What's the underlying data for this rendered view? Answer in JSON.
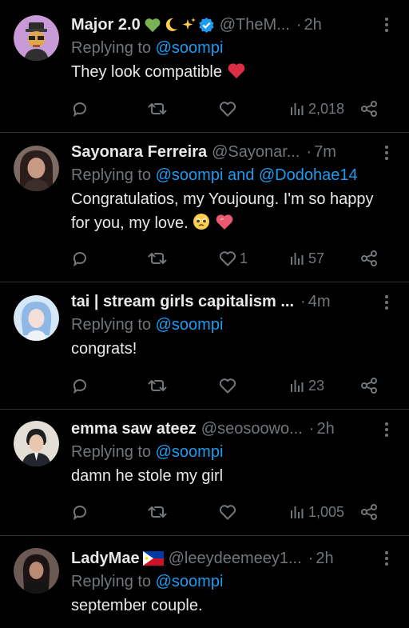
{
  "tweets": [
    {
      "name": "Major 2.0",
      "verified": true,
      "handle": "@TheM...",
      "time": "2h",
      "reply_prefix": "Replying to ",
      "reply_to": "@soompi",
      "text": "They look compatible",
      "likes": "",
      "views": "2,018"
    },
    {
      "name": "Sayonara Ferreira",
      "handle": "@Sayonar...",
      "time": "7m",
      "reply_prefix": "Replying to ",
      "reply_to": "@soompi and @Dodohae14",
      "text": "Congratulatios, my Youjoung. I'm so happy for you, my love.",
      "likes": "1",
      "views": "57"
    },
    {
      "name": "tai | stream girls capitalism ...",
      "time": "4m",
      "reply_prefix": "Replying to ",
      "reply_to": "@soompi",
      "text": "congrats!",
      "likes": "",
      "views": "23"
    },
    {
      "name": "emma saw ateez",
      "handle": "@seosoowo...",
      "time": "2h",
      "reply_prefix": "Replying to ",
      "reply_to": "@soompi",
      "text": "damn he stole my girl",
      "likes": "",
      "views": "1,005"
    },
    {
      "name": "LadyMae",
      "handle": "@leeydeemeey1...",
      "time": "2h",
      "reply_prefix": "Replying to ",
      "reply_to": "@soompi",
      "text": "september couple."
    }
  ],
  "icons": [
    "reply-icon",
    "retweet-icon",
    "heart-icon",
    "analytics-icon",
    "share-icon",
    "more-options-icon",
    "verified-badge-icon"
  ],
  "colors": {
    "background": "#000000",
    "accent": "#1d9bf0",
    "muted": "#71767b",
    "text": "#e7e9ea",
    "divider": "#2f3336",
    "verified": "#1d9bf0"
  }
}
